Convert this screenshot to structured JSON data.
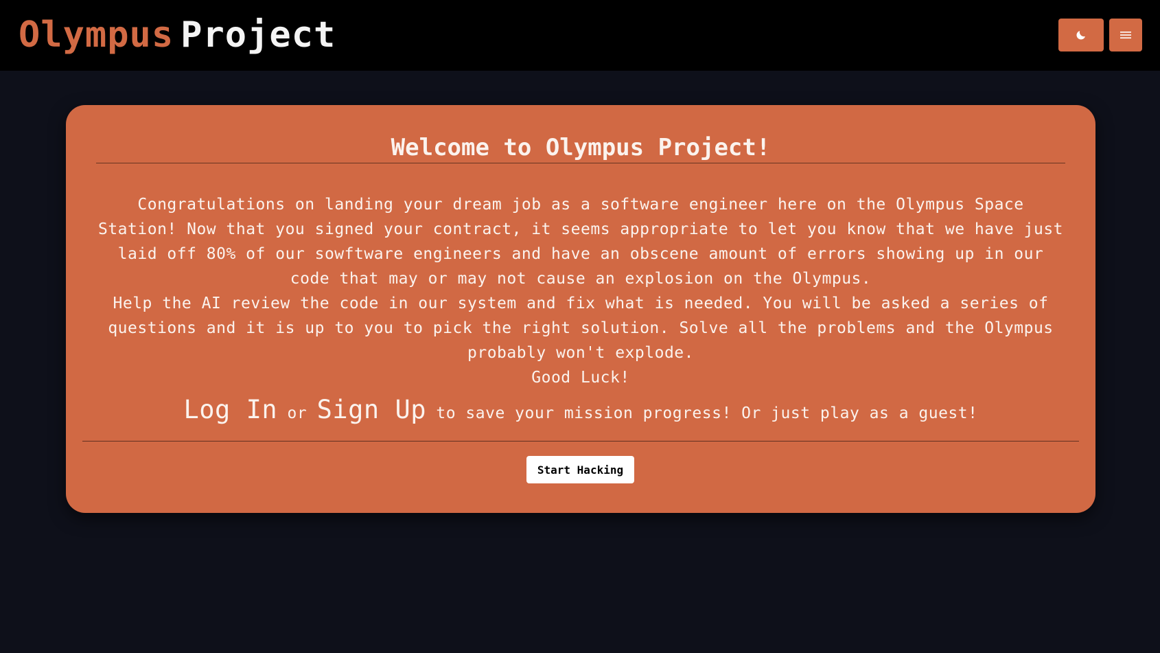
{
  "navbar": {
    "brand_accent": "Olympus",
    "brand_rest": "Project",
    "theme_toggle_icon": "moon-icon",
    "menu_icon": "hamburger-menu-icon"
  },
  "colors": {
    "accent": "#d26a44",
    "card": "#d16944",
    "page_background": "#0e101a",
    "navbar_background": "#000000",
    "text_light": "#fbf3ee"
  },
  "card": {
    "title": "Welcome to Olympus Project!",
    "paragraph1": "Congratulations on landing your dream job as a software engineer here on the Olympus Space Station! Now that you signed your contract, it seems appropriate to let you know that we have just laid off 80% of our sowftware engineers and have an obscene amount of errors showing up in our code that may or may not cause an explosion on the Olympus.",
    "paragraph2": "Help the AI review the code in our system and fix what is needed. You will be asked a series of questions and it is up to you to pick the right solution. Solve all the problems and the Olympus probably won't explode.",
    "paragraph3": "Good Luck!",
    "auth": {
      "login_label": "Log In",
      "or_text": "or",
      "signup_label": "Sign Up",
      "suffix_text": "to save your mission progress! Or just play as a guest!"
    },
    "start_button_label": "Start Hacking"
  }
}
